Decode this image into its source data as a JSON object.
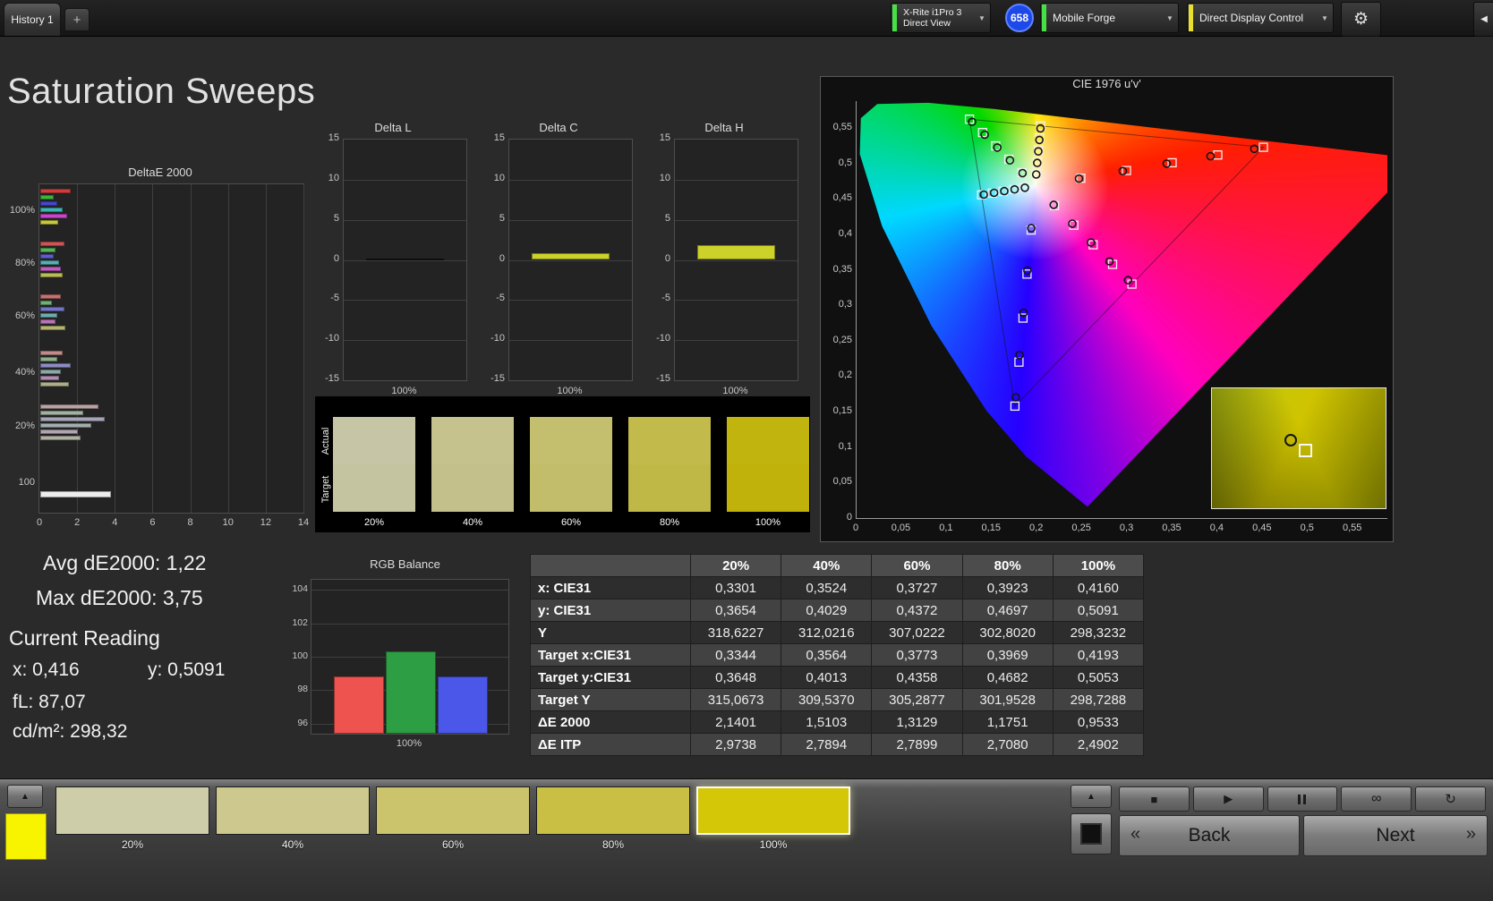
{
  "top_bar": {
    "tab": "History 1",
    "add_tab": "+",
    "meter_line1": "X-Rite i1Pro 3",
    "meter_line2": "Direct View",
    "badge": "658",
    "source": "Mobile Forge",
    "display_control": "Direct Display Control"
  },
  "icons": {
    "chevron_down": "▼",
    "gear": "⚙",
    "collapse": "◀",
    "up_arrow": "▲",
    "stop": "■",
    "play": "▶",
    "loop": "∞",
    "refresh": "↻",
    "back_chevron": "«",
    "next_chevron": "»"
  },
  "title": "Saturation Sweeps",
  "stats": {
    "avg": "Avg dE2000: 1,22",
    "max": "Max dE2000: 3,75",
    "current_reading_label": "Current Reading",
    "x": "x: 0,416",
    "y": "y: 0,5091",
    "fl": "fL: 87,07",
    "cdm2": "cd/m²: 298,32"
  },
  "swatch_panel": {
    "actual_label": "Actual",
    "target_label": "Target",
    "items": [
      {
        "label": "20%",
        "actual": "#c6c6a6",
        "target": "#c4c4a1"
      },
      {
        "label": "40%",
        "actual": "#c6c28e",
        "target": "#c4c08b"
      },
      {
        "label": "60%",
        "actual": "#c4bf6e",
        "target": "#c2bd6a"
      },
      {
        "label": "80%",
        "actual": "#c2ba4a",
        "target": "#c0b846"
      },
      {
        "label": "100%",
        "actual": "#c2b40e",
        "target": "#c0b20a"
      }
    ]
  },
  "table": {
    "headers": [
      "",
      "20%",
      "40%",
      "60%",
      "80%",
      "100%"
    ],
    "rows": [
      {
        "label": "x: CIE31",
        "values": [
          "0,3301",
          "0,3524",
          "0,3727",
          "0,3923",
          "0,4160"
        ]
      },
      {
        "label": "y: CIE31",
        "values": [
          "0,3654",
          "0,4029",
          "0,4372",
          "0,4697",
          "0,5091"
        ]
      },
      {
        "label": "Y",
        "values": [
          "318,6227",
          "312,0216",
          "307,0222",
          "302,8020",
          "298,3232"
        ]
      },
      {
        "label": "Target x:CIE31",
        "values": [
          "0,3344",
          "0,3564",
          "0,3773",
          "0,3969",
          "0,4193"
        ]
      },
      {
        "label": "Target y:CIE31",
        "values": [
          "0,3648",
          "0,4013",
          "0,4358",
          "0,4682",
          "0,5053"
        ]
      },
      {
        "label": "Target Y",
        "values": [
          "315,0673",
          "309,5370",
          "305,2877",
          "301,9528",
          "298,7288"
        ]
      },
      {
        "label": "ΔE 2000",
        "values": [
          "2,1401",
          "1,5103",
          "1,3129",
          "1,1751",
          "0,9533"
        ]
      },
      {
        "label": "ΔE ITP",
        "values": [
          "2,9738",
          "2,7894",
          "2,7899",
          "2,7080",
          "2,4902"
        ]
      }
    ]
  },
  "chart_data": [
    {
      "type": "bar",
      "orientation": "horizontal",
      "title": "DeltaE 2000",
      "xlim": [
        0,
        14
      ],
      "x_ticks": [
        0,
        2,
        4,
        6,
        8,
        10,
        12,
        14
      ],
      "groups": [
        {
          "label": "100%",
          "values": [
            1.6,
            0.7,
            0.9,
            1.2,
            1.4,
            0.95
          ],
          "colors": [
            "#d23c3c",
            "#3cb43c",
            "#4646d2",
            "#3cb4b4",
            "#c846c8",
            "#c8c83c"
          ]
        },
        {
          "label": "80%",
          "values": [
            1.3,
            0.8,
            0.7,
            1.0,
            1.1,
            1.18
          ],
          "colors": [
            "#cd5555",
            "#55b455",
            "#5c5ccd",
            "#55b0b0",
            "#c05cc0",
            "#bcbc55"
          ]
        },
        {
          "label": "60%",
          "values": [
            1.1,
            0.6,
            1.3,
            0.9,
            0.8,
            1.31
          ],
          "colors": [
            "#c87070",
            "#70b270",
            "#7474c8",
            "#70acac",
            "#b874b8",
            "#b4b470"
          ]
        },
        {
          "label": "40%",
          "values": [
            1.2,
            0.9,
            1.6,
            1.1,
            1.0,
            1.51
          ],
          "colors": [
            "#c28b8b",
            "#8bb08b",
            "#8d8dc2",
            "#8ba8a8",
            "#b08db0",
            "#adad8b"
          ]
        },
        {
          "label": "20%",
          "values": [
            3.1,
            2.3,
            3.4,
            2.7,
            2.0,
            2.14
          ],
          "colors": [
            "#b9a3a3",
            "#a3b1a3",
            "#a5a5b9",
            "#a3aeae",
            "#b2a5b2",
            "#b0b0a3"
          ]
        },
        {
          "label": "100",
          "values": [
            3.75
          ],
          "colors": [
            "#ededed"
          ]
        }
      ]
    },
    {
      "type": "bar",
      "title": "Delta L",
      "categories": [
        "100%"
      ],
      "values": [
        0.1
      ],
      "ylim": [
        -15,
        15
      ],
      "y_ticks": [
        15,
        10,
        5,
        0,
        -5,
        -10,
        -15
      ],
      "color": "#161616"
    },
    {
      "type": "bar",
      "title": "Delta C",
      "categories": [
        "100%"
      ],
      "values": [
        0.8
      ],
      "ylim": [
        -15,
        15
      ],
      "y_ticks": [
        15,
        10,
        5,
        0,
        -5,
        -10,
        -15
      ],
      "color": "#ccd22a"
    },
    {
      "type": "bar",
      "title": "Delta H",
      "categories": [
        "100%"
      ],
      "values": [
        1.8
      ],
      "ylim": [
        -15,
        15
      ],
      "y_ticks": [
        15,
        10,
        5,
        0,
        -5,
        -10,
        -15
      ],
      "color": "#ccd22a"
    },
    {
      "type": "bar",
      "title": "RGB Balance",
      "categories": [
        "100%"
      ],
      "ylim": [
        95.4,
        104.6
      ],
      "y_ticks": [
        104,
        102,
        100,
        98,
        96
      ],
      "series": [
        {
          "name": "Red",
          "value": 98.8,
          "color": "#ef5350"
        },
        {
          "name": "Green",
          "value": 100.3,
          "color": "#2e9e44"
        },
        {
          "name": "Blue",
          "value": 98.8,
          "color": "#4a57e8"
        }
      ]
    },
    {
      "type": "scatter",
      "title": "CIE 1976 u'v'",
      "axis_max": 0.588,
      "x_ticks": [
        "0",
        "0,05",
        "0,1",
        "0,15",
        "0,2",
        "0,25",
        "0,3",
        "0,35",
        "0,4",
        "0,45",
        "0,5",
        "0,55"
      ],
      "y_ticks": [
        "0",
        "0,05",
        "0,1",
        "0,15",
        "0,2",
        "0,25",
        "0,3",
        "0,35",
        "0,4",
        "0,45",
        "0,5",
        "0,55"
      ],
      "white_point": [
        0.1978,
        0.4683
      ],
      "saturations": [
        20,
        40,
        60,
        80,
        100
      ],
      "sweeps": [
        {
          "name": "red",
          "end": [
            0.4507,
            0.5229
          ]
        },
        {
          "name": "green",
          "end": [
            0.125,
            0.5625
          ]
        },
        {
          "name": "blue",
          "end": [
            0.1754,
            0.1579
          ]
        },
        {
          "name": "cyan",
          "end": [
            0.1385,
            0.4557
          ]
        },
        {
          "name": "magenta",
          "end": [
            0.305,
            0.33
          ]
        },
        {
          "name": "yellow",
          "end": [
            0.2039,
            0.5529
          ]
        }
      ]
    }
  ],
  "bottom_bar": {
    "swatches": [
      {
        "label": "20%",
        "color": "#cecdaa",
        "selected": false
      },
      {
        "label": "40%",
        "color": "#cdc98e",
        "selected": false
      },
      {
        "label": "60%",
        "color": "#cbc46c",
        "selected": false
      },
      {
        "label": "80%",
        "color": "#c9bf45",
        "selected": false
      },
      {
        "label": "100%",
        "color": "#d4c707",
        "selected": true
      }
    ],
    "active_color": "#f8f400",
    "back_label": "Back",
    "next_label": "Next"
  },
  "colors": {
    "meter_indicator": "#46e046",
    "source_indicator": "#46e046",
    "display_indicator": "#e8df2e",
    "badge_blue": "#1d49e8"
  }
}
